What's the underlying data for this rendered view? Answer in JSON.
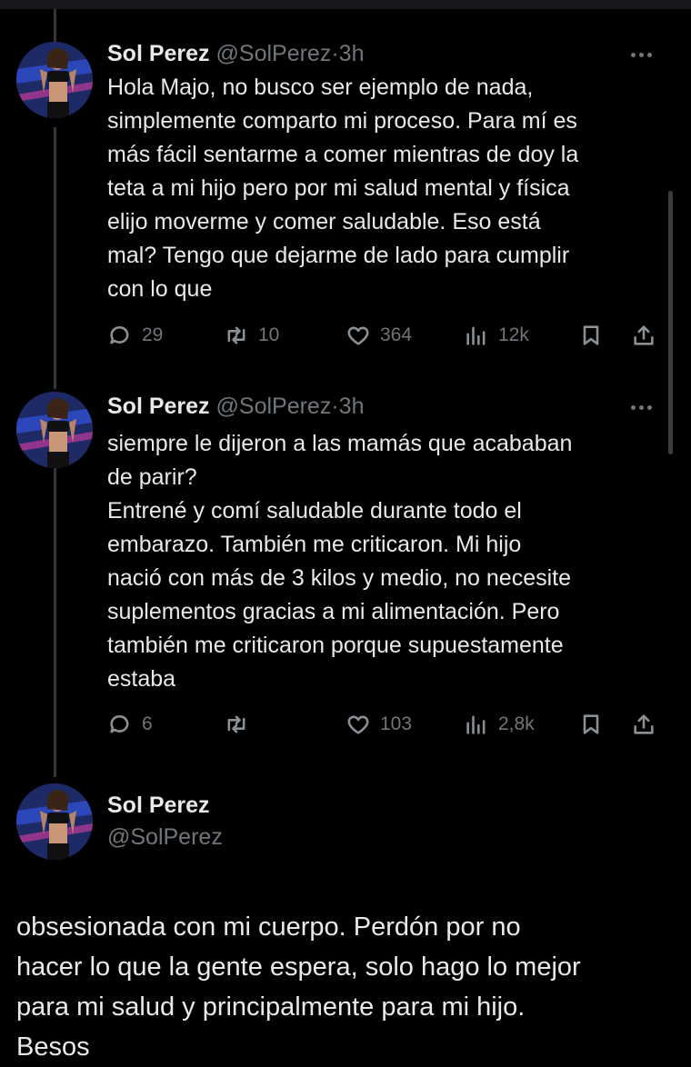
{
  "tweets": [
    {
      "name": "Sol Perez",
      "handle": "@SolPerez",
      "time": "·3h",
      "lines": [
        "Hola Majo, no busco ser ejemplo de nada,",
        "simplemente comparto mi proceso. Para mí es",
        "más fácil sentarme a comer mientras de doy la",
        "teta a mi hijo pero por mi salud mental y física",
        "elijo moverme y comer saludable. Eso está",
        "mal? Tengo que dejarme de lado para cumplir",
        "con lo que"
      ],
      "replies": "29",
      "retweets": "10",
      "likes": "364",
      "views": "12k"
    },
    {
      "name": "Sol Perez",
      "handle": "@SolPerez",
      "time": "·3h",
      "lines": [
        "siempre le dijeron a las mamás que acababan",
        "de parir?",
        "Entrené y comí saludable durante todo el",
        "embarazo. También me criticaron. Mi hijo",
        "nació con más de 3 kilos y medio, no necesite",
        "suplementos gracias a mi alimentación. Pero",
        "también me criticaron porque supuestamente",
        "estaba"
      ],
      "replies": "6",
      "retweets": "",
      "likes": "103",
      "views": "2,8k"
    }
  ],
  "main_tweet": {
    "name": "Sol Perez",
    "handle": "@SolPerez",
    "lines": [
      "obsesionada con mi cuerpo. Perdón por no",
      "hacer lo que la gente espera, solo hago lo mejor",
      "para mi salud y principalmente para mi hijo.",
      "Besos"
    ]
  },
  "icons": {
    "reply": "reply-icon",
    "retweet": "retweet-icon",
    "like": "heart-icon",
    "views": "views-icon",
    "bookmark": "bookmark-icon",
    "share": "share-icon",
    "more": "more-icon"
  },
  "colors": {
    "background": "#000000",
    "text": "#e7e9ea",
    "secondary": "#71767b",
    "avatar_bg": "#1d2a66"
  }
}
